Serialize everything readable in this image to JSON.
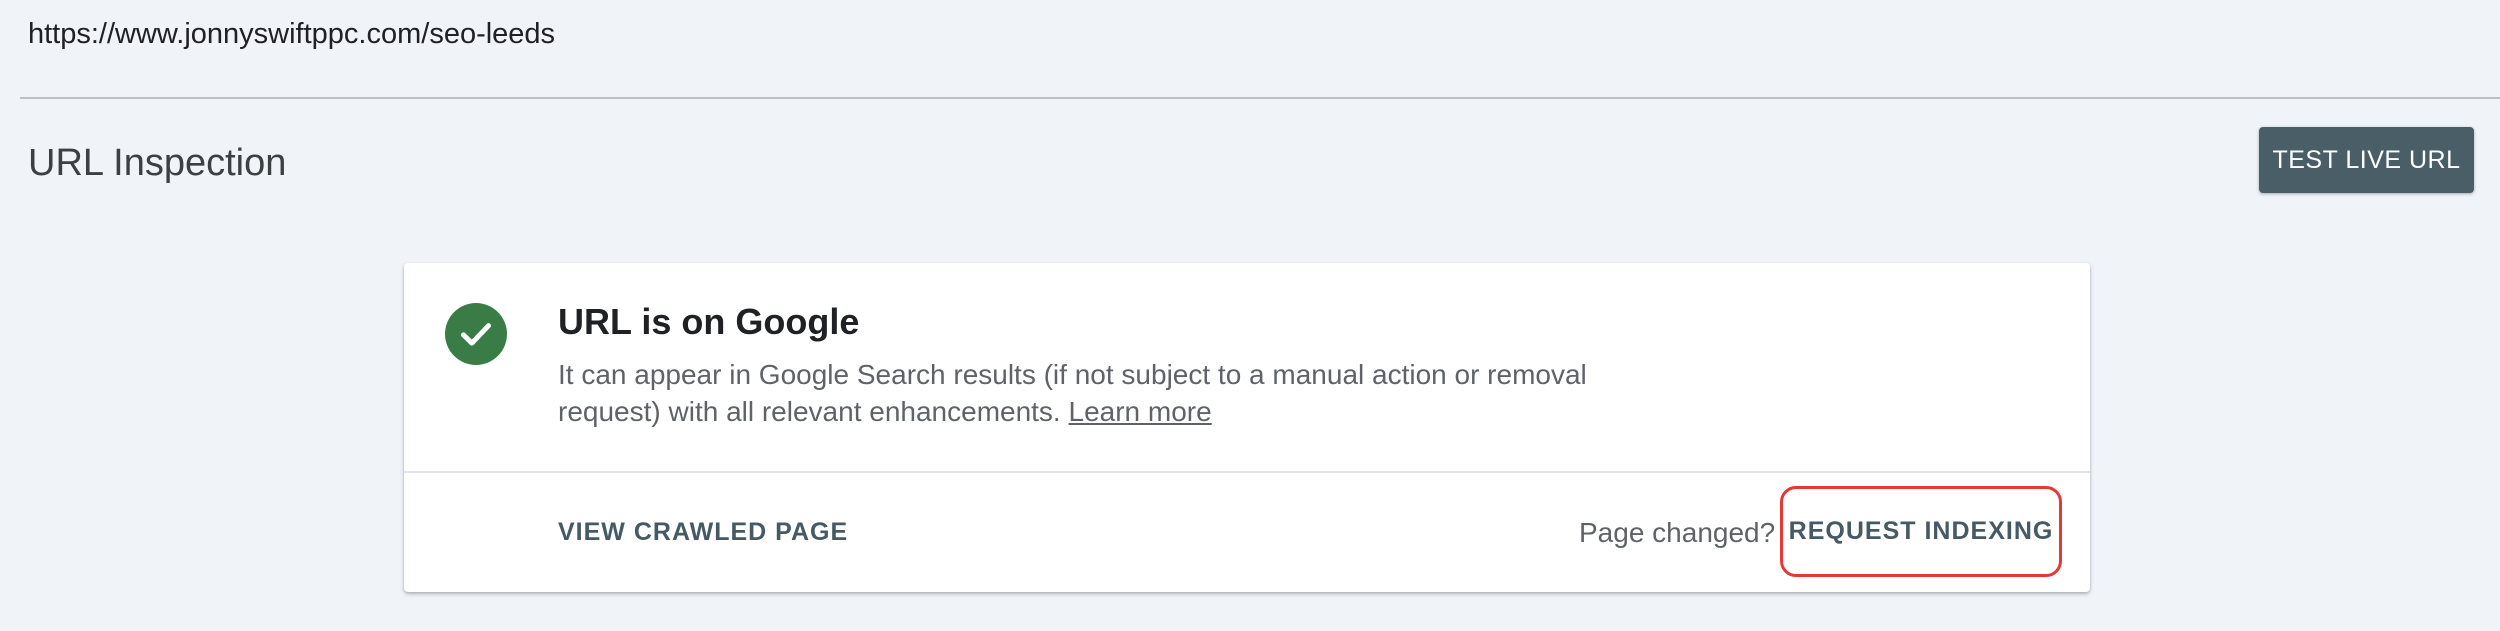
{
  "url_bar": {
    "value": "https://www.jonnyswiftppc.com/seo-leeds"
  },
  "header": {
    "title": "URL Inspection",
    "test_live_url_label": "TEST LIVE URL"
  },
  "status_card": {
    "icon": "check-circle-icon",
    "icon_color": "#3a7c45",
    "title": "URL is on Google",
    "description": "It can appear in Google Search results (if not subject to a manual action or removal request) with all relevant enhancements.",
    "learn_more_label": "Learn more",
    "view_crawled_page_label": "VIEW CRAWLED PAGE",
    "page_changed_text": "Page changed?",
    "request_indexing_label": "REQUEST INDEXING",
    "highlight_color": "#e53935"
  }
}
